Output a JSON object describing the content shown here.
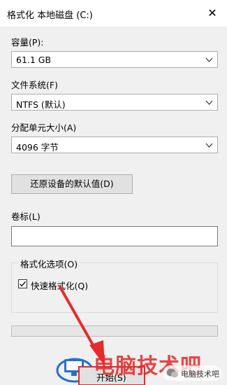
{
  "window": {
    "title": "格式化 本地磁盘 (C:)",
    "close_icon": "close-icon"
  },
  "capacity": {
    "label": "容量(P):",
    "value": "61.1 GB"
  },
  "file_system": {
    "label": "文件系统(F)",
    "value": "NTFS (默认)"
  },
  "allocation_unit": {
    "label": "分配单元大小(A)",
    "value": "4096 字节"
  },
  "restore_defaults_button": "还原设备的默认值(D)",
  "volume_label": {
    "label": "卷标(L)",
    "value": ""
  },
  "format_options": {
    "legend": "格式化选项(O)",
    "quick_format": {
      "label": "快速格式化(Q)",
      "checked": true
    }
  },
  "progress": {
    "value": 0
  },
  "start_button": "开始(S)",
  "watermark": {
    "text": "电脑技术吧",
    "badge_text": "电脑技术吧"
  },
  "colors": {
    "accent_red": "#e52b2b",
    "window_bg": "#f0f0f0",
    "watermark_blue": "#2a6fc9"
  }
}
